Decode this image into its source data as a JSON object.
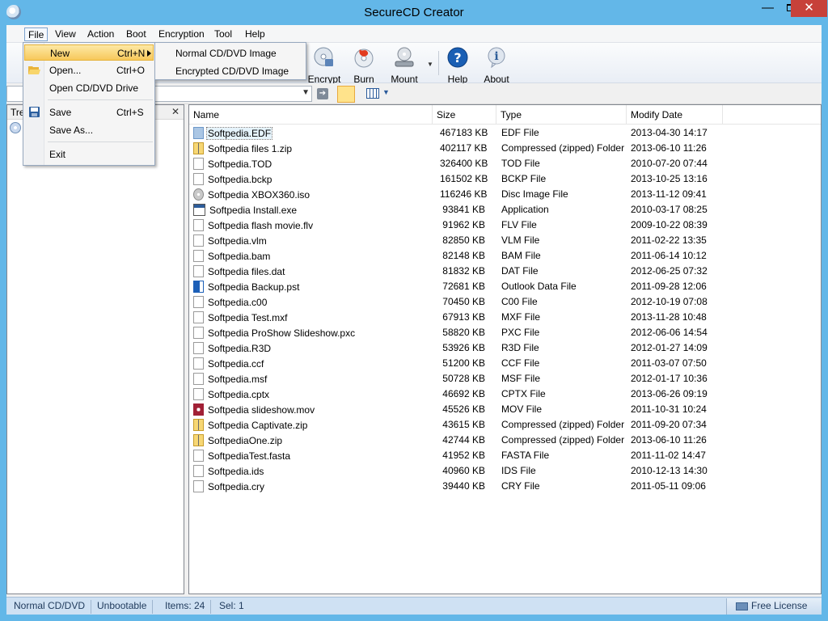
{
  "window": {
    "title": "SecureCD Creator",
    "minimize_glyph": "—",
    "close_glyph": "✕"
  },
  "menubar": {
    "items": [
      "File",
      "View",
      "Action",
      "Boot",
      "Encryption",
      "Tool",
      "Help"
    ]
  },
  "toolbar": {
    "buttons": [
      {
        "label": "Encrypt",
        "icon": "encrypt-cd-icon"
      },
      {
        "label": "Burn",
        "icon": "burn-disc-icon"
      },
      {
        "label": "Mount",
        "icon": "mount-drive-icon"
      },
      {
        "label": "Help",
        "icon": "help-icon"
      },
      {
        "label": "About",
        "icon": "about-icon"
      }
    ]
  },
  "tree": {
    "title": "Tre",
    "close_glyph": "✕"
  },
  "file_menu": {
    "items": [
      {
        "label": "New",
        "shortcut": "Ctrl+N"
      },
      {
        "label": "Open...",
        "shortcut": "Ctrl+O"
      },
      {
        "label": "Open CD/DVD Drive",
        "shortcut": ""
      },
      {
        "label": "Save",
        "shortcut": "Ctrl+S"
      },
      {
        "label": "Save As...",
        "shortcut": ""
      },
      {
        "label": "Exit",
        "shortcut": ""
      }
    ],
    "submenu": [
      "Normal CD/DVD Image",
      "Encrypted CD/DVD Image"
    ]
  },
  "columns": [
    "Name",
    "Size",
    "Type",
    "Modify Date"
  ],
  "files": [
    {
      "name": "Softpedia.EDF",
      "size": "467183 KB",
      "type": "EDF File",
      "date": "2013-04-30 14:17",
      "icon": "edf"
    },
    {
      "name": "Softpedia files 1.zip",
      "size": "402117 KB",
      "type": "Compressed (zipped) Folder",
      "date": "2013-06-10 11:26",
      "icon": "zip"
    },
    {
      "name": "Softpedia.TOD",
      "size": "326400 KB",
      "type": "TOD File",
      "date": "2010-07-20 07:44",
      "icon": "file"
    },
    {
      "name": "Softpedia.bckp",
      "size": "161502 KB",
      "type": "BCKP File",
      "date": "2013-10-25 13:16",
      "icon": "file"
    },
    {
      "name": "Softpedia XBOX360.iso",
      "size": "116246 KB",
      "type": "Disc Image File",
      "date": "2013-11-12 09:41",
      "icon": "iso"
    },
    {
      "name": "Softpedia Install.exe",
      "size": "93841 KB",
      "type": "Application",
      "date": "2010-03-17 08:25",
      "icon": "exe"
    },
    {
      "name": "Softpedia flash movie.flv",
      "size": "91962 KB",
      "type": "FLV File",
      "date": "2009-10-22 08:39",
      "icon": "file"
    },
    {
      "name": "Softpedia.vlm",
      "size": "82850 KB",
      "type": "VLM File",
      "date": "2011-02-22 13:35",
      "icon": "file"
    },
    {
      "name": "Softpedia.bam",
      "size": "82148 KB",
      "type": "BAM File",
      "date": "2011-06-14 10:12",
      "icon": "file"
    },
    {
      "name": "Softpedia files.dat",
      "size": "81832 KB",
      "type": "DAT File",
      "date": "2012-06-25 07:32",
      "icon": "file"
    },
    {
      "name": "Softpedia Backup.pst",
      "size": "72681 KB",
      "type": "Outlook Data File",
      "date": "2011-09-28 12:06",
      "icon": "pst"
    },
    {
      "name": "Softpedia.c00",
      "size": "70450 KB",
      "type": "C00 File",
      "date": "2012-10-19 07:08",
      "icon": "file"
    },
    {
      "name": "Softpedia Test.mxf",
      "size": "67913 KB",
      "type": "MXF File",
      "date": "2013-11-28 10:48",
      "icon": "file"
    },
    {
      "name": "Softpedia ProShow Slideshow.pxc",
      "size": "58820 KB",
      "type": "PXC File",
      "date": "2012-06-06 14:54",
      "icon": "file"
    },
    {
      "name": "Softpedia.R3D",
      "size": "53926 KB",
      "type": "R3D File",
      "date": "2012-01-27 14:09",
      "icon": "file"
    },
    {
      "name": "Softpedia.ccf",
      "size": "51200 KB",
      "type": "CCF File",
      "date": "2011-03-07 07:50",
      "icon": "file"
    },
    {
      "name": "Softpedia.msf",
      "size": "50728 KB",
      "type": "MSF File",
      "date": "2012-01-17 10:36",
      "icon": "file"
    },
    {
      "name": "Softpedia.cptx",
      "size": "46692 KB",
      "type": "CPTX File",
      "date": "2013-06-26 09:19",
      "icon": "file"
    },
    {
      "name": "Softpedia slideshow.mov",
      "size": "45526 KB",
      "type": "MOV File",
      "date": "2011-10-31 10:24",
      "icon": "mov"
    },
    {
      "name": "Softpedia Captivate.zip",
      "size": "43615 KB",
      "type": "Compressed (zipped) Folder",
      "date": "2011-09-20 07:34",
      "icon": "zip"
    },
    {
      "name": "SoftpediaOne.zip",
      "size": "42744 KB",
      "type": "Compressed (zipped) Folder",
      "date": "2013-06-10 11:26",
      "icon": "zip"
    },
    {
      "name": "SoftpediaTest.fasta",
      "size": "41952 KB",
      "type": "FASTA File",
      "date": "2011-11-02 14:47",
      "icon": "file"
    },
    {
      "name": "Softpedia.ids",
      "size": "40960 KB",
      "type": "IDS File",
      "date": "2010-12-13 14:30",
      "icon": "file"
    },
    {
      "name": "Softpedia.cry",
      "size": "39440 KB",
      "type": "CRY File",
      "date": "2011-05-11 09:06",
      "icon": "file"
    }
  ],
  "status": {
    "mode": "Normal CD/DVD",
    "boot": "Unbootable",
    "items": "Items: 24",
    "sel": "Sel: 1",
    "license": "Free License"
  }
}
